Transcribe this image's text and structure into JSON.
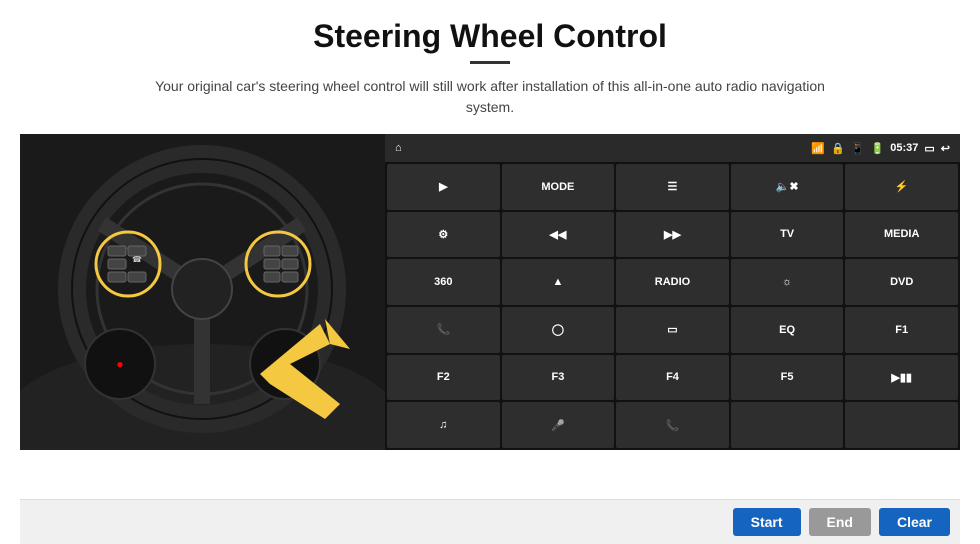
{
  "header": {
    "title": "Steering Wheel Control",
    "subtitle": "Your original car's steering wheel control will still work after installation of this all-in-one auto radio navigation system."
  },
  "status_bar": {
    "time": "05:37",
    "icons": [
      "wifi",
      "lock",
      "sim",
      "bluetooth",
      "screen",
      "back"
    ]
  },
  "grid_buttons": [
    {
      "label": "⌂",
      "type": "icon"
    },
    {
      "label": "▶",
      "type": "icon"
    },
    {
      "label": "MODE",
      "type": "text"
    },
    {
      "label": "≡",
      "type": "icon"
    },
    {
      "label": "🔇",
      "type": "icon"
    },
    {
      "label": "⚙",
      "type": "icon"
    },
    {
      "label": "⚙",
      "type": "icon"
    },
    {
      "label": "⏮",
      "type": "icon"
    },
    {
      "label": "⏭",
      "type": "icon"
    },
    {
      "label": "TV",
      "type": "text"
    },
    {
      "label": "MEDIA",
      "type": "text"
    },
    {
      "label": "360",
      "type": "icon"
    },
    {
      "label": "⏏",
      "type": "icon"
    },
    {
      "label": "RADIO",
      "type": "text"
    },
    {
      "label": "☀",
      "type": "icon"
    },
    {
      "label": "DVD",
      "type": "text"
    },
    {
      "label": "📞",
      "type": "icon"
    },
    {
      "label": "◎",
      "type": "icon"
    },
    {
      "label": "▭",
      "type": "icon"
    },
    {
      "label": "EQ",
      "type": "text"
    },
    {
      "label": "F1",
      "type": "text"
    },
    {
      "label": "F2",
      "type": "text"
    },
    {
      "label": "F3",
      "type": "text"
    },
    {
      "label": "F4",
      "type": "text"
    },
    {
      "label": "F5",
      "type": "text"
    },
    {
      "label": "⏯",
      "type": "icon"
    },
    {
      "label": "♪",
      "type": "icon"
    },
    {
      "label": "🎤",
      "type": "icon"
    },
    {
      "label": "📞",
      "type": "icon"
    },
    {
      "label": "",
      "type": "empty"
    }
  ],
  "bottom_buttons": {
    "start_label": "Start",
    "end_label": "End",
    "clear_label": "Clear"
  },
  "colors": {
    "start_bg": "#1565c0",
    "end_bg": "#999999",
    "clear_bg": "#1565c0",
    "header_bg": "#2a2a2a",
    "unit_bg": "#2e2e2e",
    "grid_bg": "#111111"
  }
}
